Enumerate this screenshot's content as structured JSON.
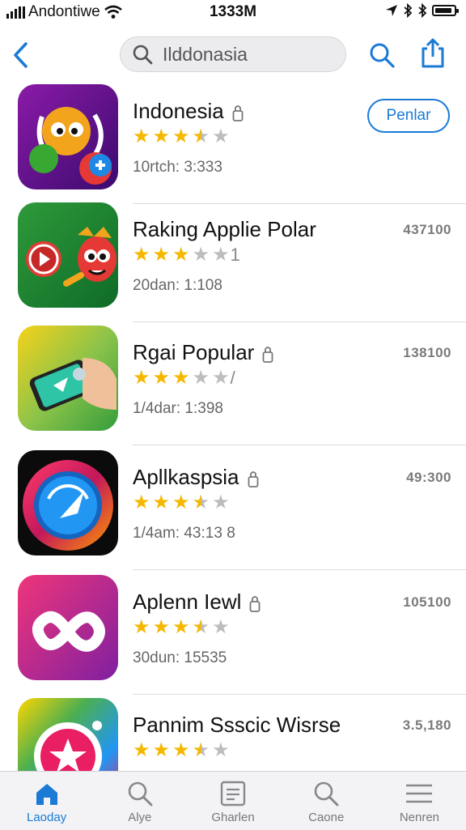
{
  "status_bar": {
    "carrier": "Andontiwe",
    "time": "1333M"
  },
  "nav": {
    "search_value": "Ilddonasia",
    "icons": [
      "back-chevron-icon",
      "search-icon",
      "share-icon"
    ]
  },
  "apps": [
    {
      "name": "Indonesia",
      "rating": 3.5,
      "rating_suffix": "",
      "meta": "10rtch: 3:333",
      "right_value": "",
      "button": "Penlar",
      "locked": true
    },
    {
      "name": "Raking Applie Polar",
      "rating": 3,
      "rating_suffix": "1",
      "meta": "20dan: 1:108",
      "right_value": "437100",
      "button": "",
      "locked": false
    },
    {
      "name": "Rgai Popular",
      "rating": 3,
      "rating_suffix": "/",
      "meta": "1/4dar: 1:398",
      "right_value": "138100",
      "button": "",
      "locked": true
    },
    {
      "name": "Apllkaspsia",
      "rating": 3.5,
      "rating_suffix": "",
      "meta": "1/4am: 43:13 8",
      "right_value": "49:300",
      "button": "",
      "locked": true
    },
    {
      "name": "Aplenn Iewl",
      "rating": 3.5,
      "rating_suffix": "",
      "meta": "30dun: 15535",
      "right_value": "105100",
      "button": "",
      "locked": true
    },
    {
      "name": "Pannim Ssscic Wisrse",
      "rating": 3.5,
      "rating_suffix": "",
      "meta": "",
      "right_value": "3.5,180",
      "button": "",
      "locked": false
    }
  ],
  "tabs": [
    {
      "label": "Laoday",
      "icon": "home-icon",
      "active": true
    },
    {
      "label": "Alye",
      "icon": "search-icon",
      "active": false
    },
    {
      "label": "Gharlen",
      "icon": "document-icon",
      "active": false
    },
    {
      "label": "Caone",
      "icon": "search-icon",
      "active": false
    },
    {
      "label": "Nenren",
      "icon": "menu-icon",
      "active": false
    }
  ],
  "colors": {
    "accent": "#1a7ad6",
    "star": "#f5b800"
  }
}
